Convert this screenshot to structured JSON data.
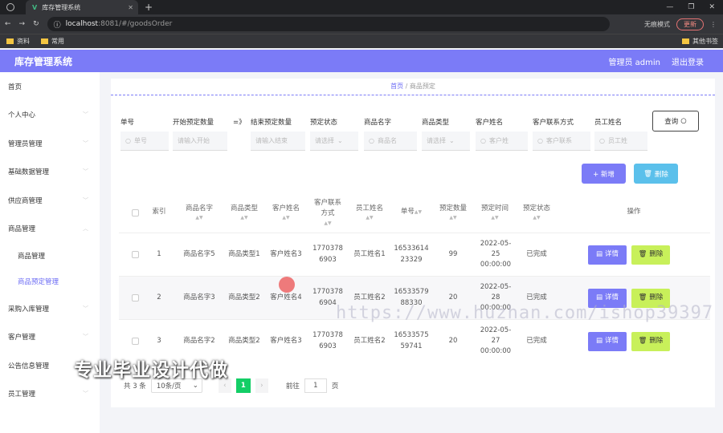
{
  "browser": {
    "tab_title": "库存管理系统",
    "url_host": "localhost",
    "url_path": ":8081/#/goodsOrder",
    "incognito": "无痕模式",
    "update": "更新",
    "bookmarks": [
      "资料",
      "常用"
    ],
    "other_bookmarks": "其他书签"
  },
  "header": {
    "title": "库存管理系统",
    "user": "管理员 admin",
    "logout": "退出登录"
  },
  "sidebar": {
    "items": [
      "首页",
      "个人中心",
      "管理员管理",
      "基础数据管理",
      "供应商管理",
      "商品管理"
    ],
    "sub": [
      "商品管理",
      "商品预定管理"
    ],
    "items2": [
      "采购入库管理",
      "客户管理",
      "公告信息管理",
      "员工管理"
    ]
  },
  "breadcrumb": {
    "home": "首页",
    "sep": "/",
    "current": "商品预定"
  },
  "filters": {
    "labels": [
      "单号",
      "开始预定数量",
      "=》",
      "结束预定数量",
      "预定状态",
      "商品名字",
      "商品类型",
      "客户姓名",
      "客户联系方式",
      "员工姓名"
    ],
    "placeholders": [
      "单号",
      "请输入开始",
      "请输入结束",
      "请选择",
      "商品名",
      "请选择",
      "客户姓",
      "客户联系",
      "员工姓"
    ],
    "query": "查询"
  },
  "actions": {
    "add": "+ 新增",
    "delete": "删除"
  },
  "table": {
    "headers": [
      "索引",
      "商品名字",
      "商品类型",
      "客户姓名",
      "客户联系方式",
      "员工姓名",
      "单号",
      "预定数量",
      "预定时间",
      "预定状态",
      "操作"
    ],
    "rows": [
      {
        "idx": "1",
        "name": "商品名字5",
        "type": "商品类型1",
        "cust": "客户姓名3",
        "phone": "17703786903",
        "emp": "员工姓名1",
        "no": "1653361423329",
        "qty": "99",
        "time": "2022-05-25 00:00:00",
        "status": "已完成"
      },
      {
        "idx": "2",
        "name": "商品名字3",
        "type": "商品类型2",
        "cust": "客户姓名4",
        "phone": "17703786904",
        "emp": "员工姓名2",
        "no": "1653357988330",
        "qty": "20",
        "time": "2022-05-28 00:00:00",
        "status": "已完成"
      },
      {
        "idx": "3",
        "name": "商品名字2",
        "type": "商品类型2",
        "cust": "客户姓名3",
        "phone": "17703786903",
        "emp": "员工姓名2",
        "no": "1653357559741",
        "qty": "20",
        "time": "2022-05-27 00:00:00",
        "status": "已完成"
      }
    ],
    "detail": "详情",
    "del": "删除"
  },
  "pager": {
    "total": "共 3 条",
    "size": "10条/页",
    "page": "1",
    "goto": "前往",
    "goto_val": "1",
    "page_unit": "页"
  },
  "watermark": {
    "url": "https://www.huzhan.com/ishop39397",
    "promo": "专业毕业设计代做"
  },
  "colors": {
    "primary": "#7b7bf7",
    "delete_btn": "#5bc0eb",
    "row_delete": "#c8f05a",
    "page_active": "#13ce66"
  }
}
